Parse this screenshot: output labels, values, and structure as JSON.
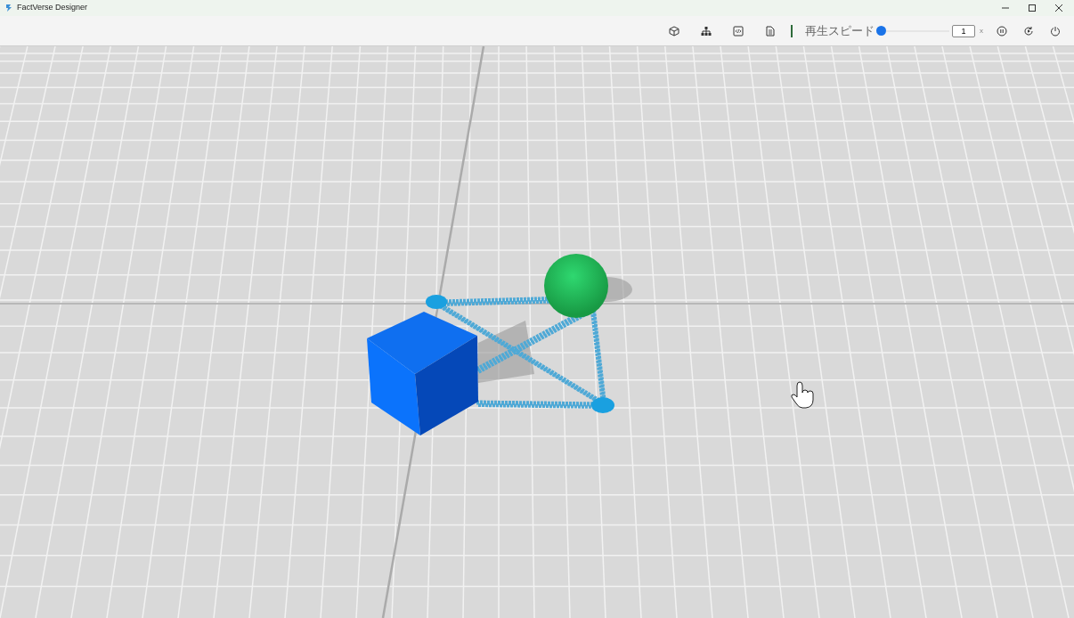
{
  "window": {
    "title": "FactVerse Designer"
  },
  "toolbar": {
    "tools": [
      {
        "kind": "cube"
      },
      {
        "kind": "hierarchy"
      },
      {
        "kind": "code"
      },
      {
        "kind": "document"
      }
    ],
    "speed": {
      "label": "再生スピード",
      "level": 0,
      "value": "1",
      "unit": "x"
    },
    "actions": [
      {
        "kind": "pause"
      },
      {
        "kind": "replay"
      },
      {
        "kind": "power"
      }
    ]
  }
}
